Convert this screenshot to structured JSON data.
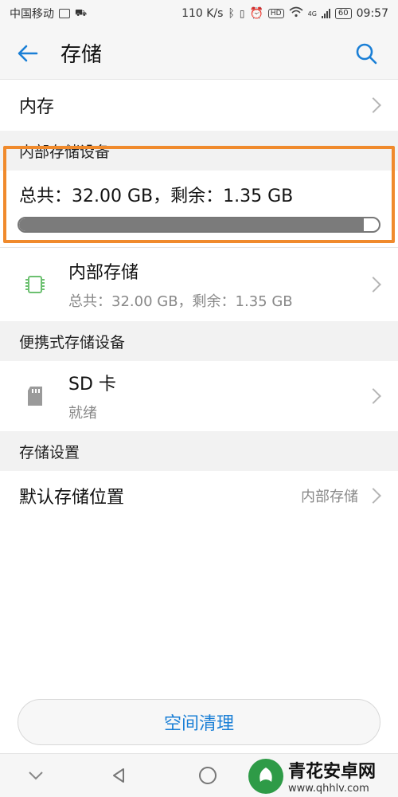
{
  "status_bar": {
    "carrier": "中国移动",
    "speed": "110 K/s",
    "network": "4G",
    "battery": "60",
    "time": "09:57"
  },
  "header": {
    "title": "存储",
    "back_icon": "arrow-left-icon",
    "search_icon": "search-icon"
  },
  "memory_row": {
    "label": "内存"
  },
  "internal_section": {
    "header": "内部存储设备",
    "summary": "总共：32.00 GB，剩余：1.35 GB",
    "used_fraction": 0.958
  },
  "internal_item": {
    "title": "内部存储",
    "detail": "总共：32.00 GB，剩余：1.35 GB",
    "icon": "chip-icon"
  },
  "portable_section": {
    "header": "便携式存储设备"
  },
  "sd_item": {
    "title": "SD 卡",
    "status": "就绪",
    "icon": "sd-card-icon"
  },
  "settings_section": {
    "header": "存储设置"
  },
  "default_location": {
    "label": "默认存储位置",
    "value": "内部存储"
  },
  "clean_button": "空间清理",
  "colors": {
    "accent": "#1a7fd6",
    "highlight": "#f08a2c",
    "chip": "#6cc070"
  },
  "watermark": {
    "name": "青花安卓网",
    "url": "www.qhhlv.com"
  }
}
